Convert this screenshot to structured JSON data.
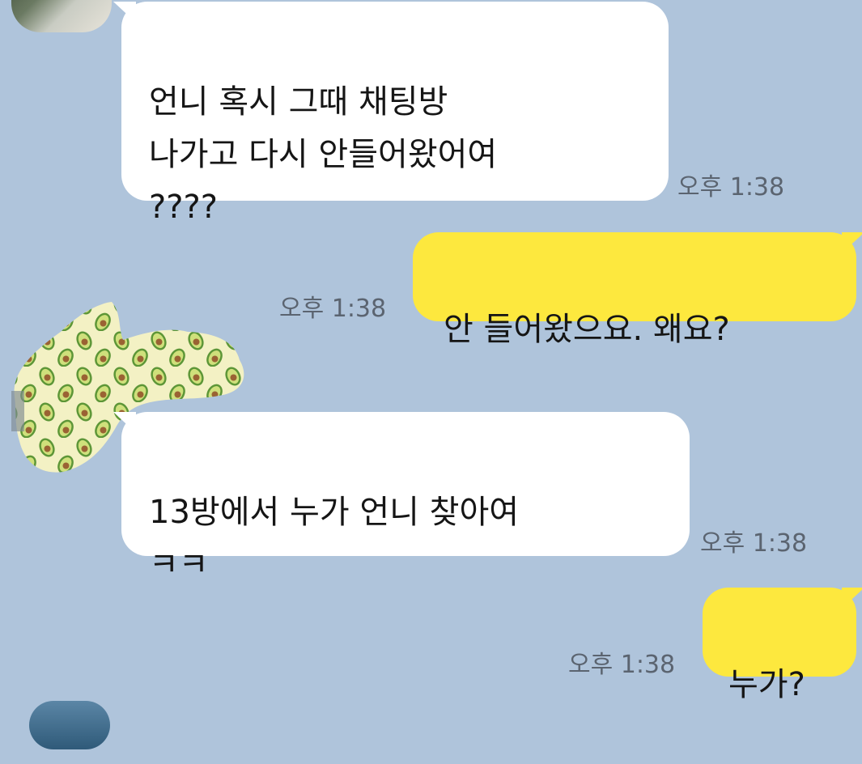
{
  "messages": [
    {
      "direction": "incoming",
      "text": "언니 혹시 그때 채팅방\n나가고 다시 안들어왔어여\n????",
      "time": "오후 1:38"
    },
    {
      "direction": "outgoing",
      "text": "안 들어왔으요. 왜요?",
      "time": "오후 1:38"
    },
    {
      "direction": "incoming",
      "text": "13방에서 누가 언니 찾아여\nㅋㅋ",
      "time": "오후 1:38"
    },
    {
      "direction": "outgoing",
      "text": "누가?",
      "time": "오후 1:38"
    }
  ],
  "colors": {
    "background": "#afc4db",
    "incoming_bubble": "#ffffff",
    "outgoing_bubble": "#fde83e",
    "timestamp_text": "#5b6470",
    "message_text": "#151515"
  },
  "icons": {
    "avatar_top": "profile-photo",
    "avatar_middle": "avocado-pattern-profile",
    "avatar_bottom": "profile-photo"
  }
}
